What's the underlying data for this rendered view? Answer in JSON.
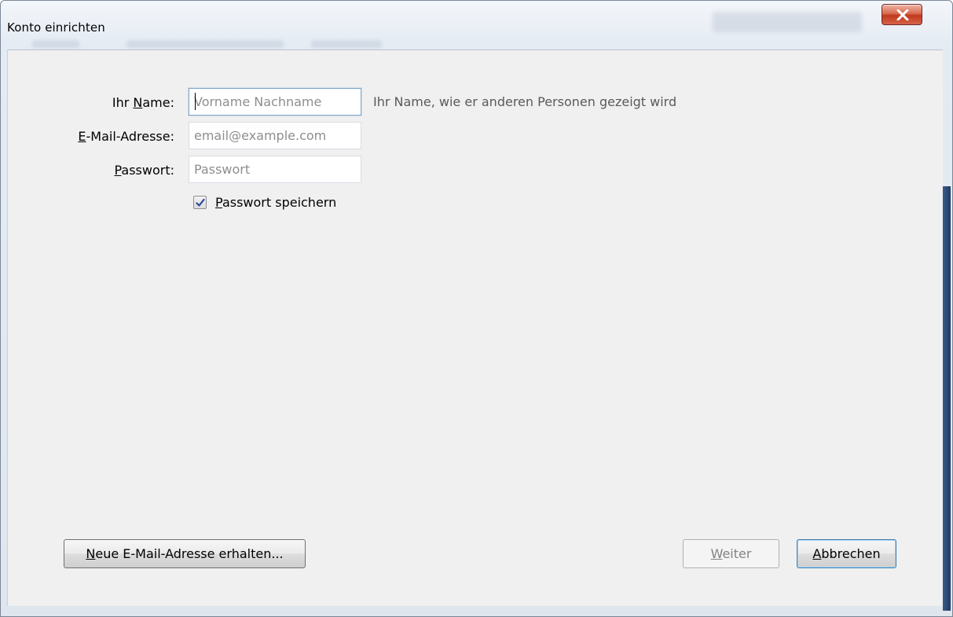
{
  "window": {
    "title": "Konto einrichten"
  },
  "form": {
    "name": {
      "label_pre": "Ihr ",
      "label_key": "N",
      "label_post": "ame:",
      "placeholder": "Vorname Nachname",
      "value": "",
      "hint": "Ihr Name, wie er anderen Personen gezeigt wird"
    },
    "email": {
      "label_key": "E",
      "label_post": "-Mail-Adresse:",
      "placeholder": "email@example.com",
      "value": ""
    },
    "password": {
      "label_key": "P",
      "label_post": "asswort:",
      "placeholder": "Passwort",
      "value": ""
    },
    "save_password": {
      "label_key": "P",
      "label_post": "asswort speichern",
      "checked": true
    }
  },
  "buttons": {
    "new_email": {
      "key": "N",
      "rest": "eue E-Mail-Adresse erhalten..."
    },
    "next": {
      "key": "W",
      "rest": "eiter",
      "disabled": true
    },
    "cancel": {
      "key": "A",
      "rest": "bbrechen"
    }
  },
  "colors": {
    "close_button": "#c7432a",
    "focus_border": "#7ea6cf",
    "hint_text": "#5a5a5a",
    "checkbox_mark": "#2c4a9a"
  },
  "icons": {
    "close": "close-x-icon",
    "checkbox": "checkmark-icon"
  }
}
